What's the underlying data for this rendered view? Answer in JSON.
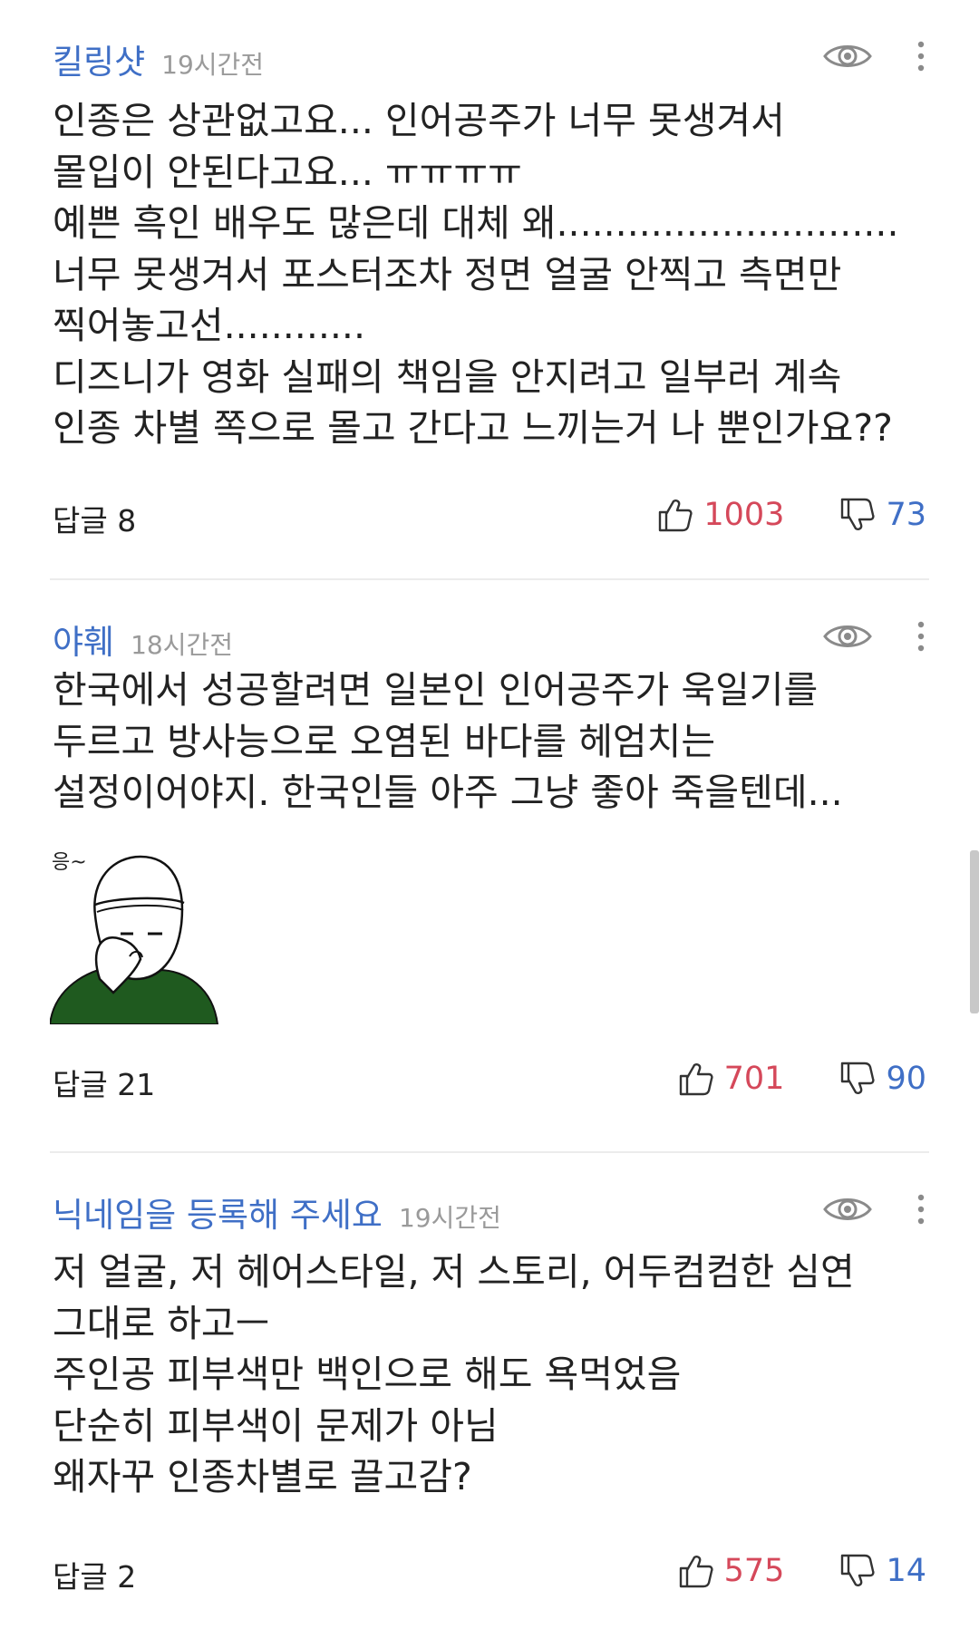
{
  "comments": [
    {
      "nickname": "킬링샷",
      "time": "19시간전",
      "text": "인종은 상관없고요... 인어공주가 너무 못생겨서\n몰입이 안된다고요... ㅠㅠㅠㅠ\n예쁜 흑인 배우도 많은데 대체 왜.............................\n너무 못생겨서 포스터조차 정면 얼굴 안찍고 측면만\n찍어놓고선............\n디즈니가 영화 실패의 책임을 안지려고 일부러 계속\n인종 차별 쪽으로 몰고 간다고 느끼는거 나 뿐인가요??",
      "reply": "답글 8",
      "likes": "1003",
      "dislikes": "73"
    },
    {
      "nickname": "야훼",
      "time": "18시간전",
      "text": "한국에서 성공할려면 일본인 인어공주가 욱일기를\n두르고 방사능으로 오염된 바다를 헤엄치는\n설정이어야지. 한국인들 아주 그냥 좋아 죽을텐데...",
      "sticker_caption": "응~",
      "reply": "답글 21",
      "likes": "701",
      "dislikes": "90"
    },
    {
      "nickname": "닉네임을 등록해 주세요",
      "time": "19시간전",
      "text": "저 얼굴, 저 헤어스타일, 저 스토리, 어두컴컴한 심연\n그대로 하고ㅡ\n주인공 피부색만 백인으로 해도 욕먹었음\n단순히 피부색이 문제가 아님\n왜자꾸 인종차별로 끌고감?",
      "reply": "답글 2",
      "likes": "575",
      "dislikes": "14"
    }
  ],
  "icons": {
    "view": "eye-icon",
    "menu": "more-vertical-icon",
    "like": "thumbs-up-icon",
    "dislike": "thumbs-down-icon"
  },
  "colors": {
    "nickname": "#3f6fc6",
    "like": "#d5485a",
    "dislike": "#3f6fc6",
    "sticker_shirt": "#1f5a1f"
  }
}
